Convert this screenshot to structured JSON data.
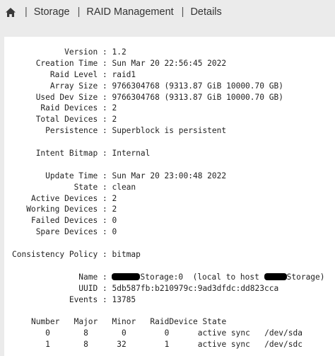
{
  "breadcrumb": {
    "home_icon": "home-icon",
    "items": [
      "Storage",
      "RAID Management",
      "Details"
    ]
  },
  "details": {
    "version": {
      "label": "Version",
      "value": "1.2"
    },
    "creation_time": {
      "label": "Creation Time",
      "value": "Sun Mar 20 22:56:45 2022"
    },
    "raid_level": {
      "label": "Raid Level",
      "value": "raid1"
    },
    "array_size": {
      "label": "Array Size",
      "value": "9766304768 (9313.87 GiB 10000.70 GB)"
    },
    "used_dev_size": {
      "label": "Used Dev Size",
      "value": "9766304768 (9313.87 GiB 10000.70 GB)"
    },
    "raid_devices": {
      "label": "Raid Devices",
      "value": "2"
    },
    "total_devices": {
      "label": "Total Devices",
      "value": "2"
    },
    "persistence": {
      "label": "Persistence",
      "value": "Superblock is persistent"
    },
    "intent_bitmap": {
      "label": "Intent Bitmap",
      "value": "Internal"
    },
    "update_time": {
      "label": "Update Time",
      "value": "Sun Mar 20 23:00:48 2022"
    },
    "state": {
      "label": "State",
      "value": "clean"
    },
    "active_devices": {
      "label": "Active Devices",
      "value": "2"
    },
    "working_devices": {
      "label": "Working Devices",
      "value": "2"
    },
    "failed_devices": {
      "label": "Failed Devices",
      "value": "0"
    },
    "spare_devices": {
      "label": "Spare Devices",
      "value": "0"
    },
    "consistency_policy": {
      "label": "Consistency Policy",
      "value": "bitmap"
    },
    "name": {
      "label": "Name",
      "value_part1": "Storage:0",
      "value_part2": "(local to host",
      "value_part3": "Storage)"
    },
    "uuid": {
      "label": "UUID",
      "value": "5db587fb:b210979c:9ad3dfdc:dd823cca"
    },
    "events": {
      "label": "Events",
      "value": "13785"
    }
  },
  "device_table": {
    "headers": [
      "Number",
      "Major",
      "Minor",
      "RaidDevice",
      "State"
    ],
    "rows": [
      {
        "number": "0",
        "major": "8",
        "minor": "0",
        "raid_device": "0",
        "state": "active sync",
        "device": "/dev/sda"
      },
      {
        "number": "1",
        "major": "8",
        "minor": "32",
        "raid_device": "1",
        "state": "active sync",
        "device": "/dev/sdc"
      }
    ]
  }
}
